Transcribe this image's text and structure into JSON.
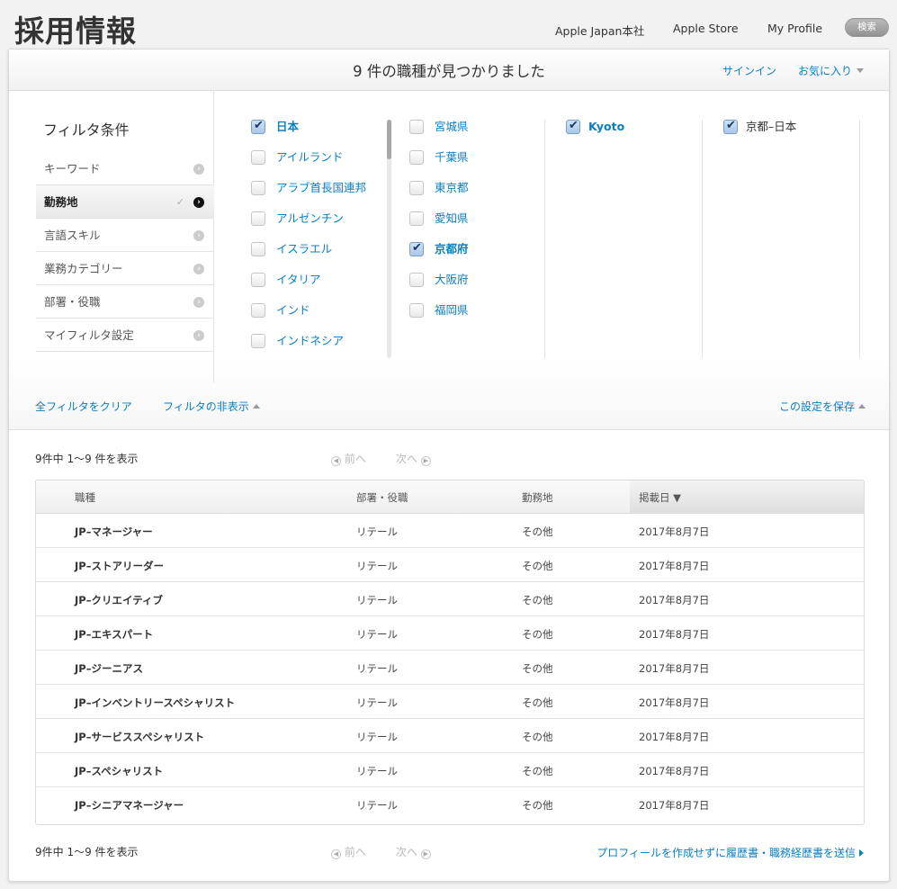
{
  "site": {
    "title": "採用情報"
  },
  "topnav": {
    "items": [
      "Apple Japan本社",
      "Apple Store",
      "My Profile"
    ],
    "search_label": "検索"
  },
  "header": {
    "results_title": "9 件の職種が見つかりました",
    "signin": "サインイン",
    "favorites": "お気に入り"
  },
  "filters": {
    "heading": "フィルタ条件",
    "categories": [
      {
        "label": "キーワード",
        "active": false
      },
      {
        "label": "勤務地",
        "active": true
      },
      {
        "label": "言語スキル",
        "active": false
      },
      {
        "label": "業務カテゴリー",
        "active": false
      },
      {
        "label": "部署・役職",
        "active": false
      },
      {
        "label": "マイフィルタ設定",
        "active": false
      }
    ],
    "countries": [
      {
        "label": "日本",
        "checked": true
      },
      {
        "label": "アイルランド",
        "checked": false
      },
      {
        "label": "アラブ首長国連邦",
        "checked": false
      },
      {
        "label": "アルゼンチン",
        "checked": false
      },
      {
        "label": "イスラエル",
        "checked": false
      },
      {
        "label": "イタリア",
        "checked": false
      },
      {
        "label": "インド",
        "checked": false
      },
      {
        "label": "インドネシア",
        "checked": false
      }
    ],
    "prefectures": [
      {
        "label": "宮城県",
        "checked": false
      },
      {
        "label": "千葉県",
        "checked": false
      },
      {
        "label": "東京都",
        "checked": false
      },
      {
        "label": "愛知県",
        "checked": false
      },
      {
        "label": "京都府",
        "checked": true
      },
      {
        "label": "大阪府",
        "checked": false
      },
      {
        "label": "福岡県",
        "checked": false
      }
    ],
    "cities": [
      {
        "label": "Kyoto",
        "checked": true
      }
    ],
    "selected": [
      {
        "label": "京都–日本",
        "checked": true
      }
    ],
    "clear_all": "全フィルタをクリア",
    "hide_filters": "フィルタの非表示",
    "save_settings": "この設定を保存"
  },
  "pagination": {
    "summary": "9件中 1〜9 件を表示",
    "prev": "前へ",
    "next": "次へ"
  },
  "table": {
    "columns": [
      "職種",
      "部署・役職",
      "勤務地",
      "掲載日 ▼"
    ],
    "rows": [
      [
        "JP–マネージャー",
        "リテール",
        "その他",
        "2017年8月7日"
      ],
      [
        "JP–ストアリーダー",
        "リテール",
        "その他",
        "2017年8月7日"
      ],
      [
        "JP–クリエイティブ",
        "リテール",
        "その他",
        "2017年8月7日"
      ],
      [
        "JP–エキスパート",
        "リテール",
        "その他",
        "2017年8月7日"
      ],
      [
        "JP–ジーニアス",
        "リテール",
        "その他",
        "2017年8月7日"
      ],
      [
        "JP–インベントリースペシャリスト",
        "リテール",
        "その他",
        "2017年8月7日"
      ],
      [
        "JP–サービススペシャリスト",
        "リテール",
        "その他",
        "2017年8月7日"
      ],
      [
        "JP–スペシャリスト",
        "リテール",
        "その他",
        "2017年8月7日"
      ],
      [
        "JP–シニアマネージャー",
        "リテール",
        "その他",
        "2017年8月7日"
      ]
    ]
  },
  "footer": {
    "submit_link": "プロフィールを作成せずに履歴書・職務経歴書を送信"
  },
  "colors": {
    "link": "#0a7fc2",
    "checkbox_on": "#a9c8e8"
  }
}
